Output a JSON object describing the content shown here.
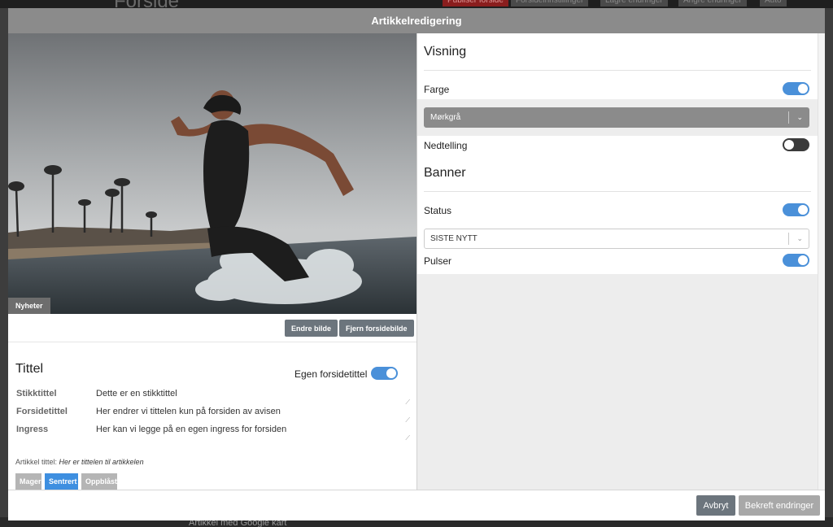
{
  "background": {
    "page_title": "Forside",
    "buttons": [
      "Publiser forside",
      "Forsideinnstillinger",
      "Lagre endringer",
      "Angre endringer",
      "Auto"
    ],
    "bottom_article": "Artikkel med Google kart"
  },
  "modal": {
    "title": "Artikkelredigering"
  },
  "image": {
    "category": "Nyheter",
    "change_label": "Endre bilde",
    "remove_label": "Fjern forsidebilde"
  },
  "title_section": {
    "heading": "Tittel",
    "own_title_label": "Egen forsidetittel",
    "own_title_on": true,
    "fields": [
      {
        "label": "Stikktittel",
        "value": "Dette er en stikktittel"
      },
      {
        "label": "Forsidetittel",
        "value": "Her endrer vi tittelen kun på forsiden av avisen"
      },
      {
        "label": "Ingress",
        "value": "Her kan vi legge på en egen ingress for forsiden"
      }
    ],
    "article_title_label": "Artikkel tittel:",
    "article_title_value": "Her er tittelen til artikkelen",
    "styles": [
      {
        "label": "Mager",
        "active": false
      },
      {
        "label": "Sentrert",
        "active": true
      },
      {
        "label": "Oppblåst",
        "active": false
      }
    ]
  },
  "visning": {
    "heading": "Visning",
    "farge_label": "Farge",
    "farge_on": true,
    "farge_value": "Mørkgrå",
    "nedtelling_label": "Nedtelling",
    "nedtelling_on": false
  },
  "banner": {
    "heading": "Banner",
    "status_label": "Status",
    "status_on": true,
    "status_value": "SISTE NYTT",
    "pulser_label": "Pulser",
    "pulser_on": true
  },
  "footer": {
    "cancel_label": "Avbryt",
    "confirm_label": "Bekreft endringer"
  },
  "colors": {
    "accent": "#4a90d9",
    "header": "#8b8b8b",
    "active_style": "#3e8fe0",
    "inactive_style": "#b5b5b5"
  }
}
